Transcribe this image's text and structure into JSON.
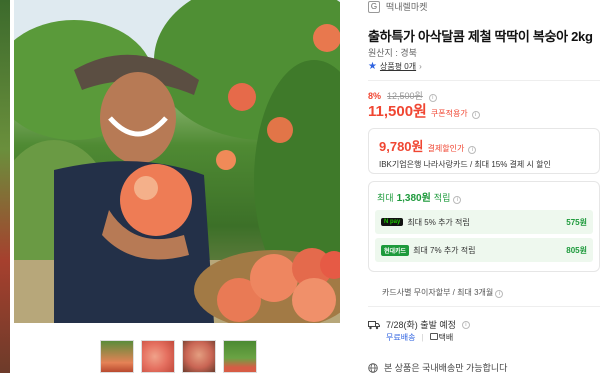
{
  "store": {
    "logo_text": "G",
    "name": "떡내렐마켓"
  },
  "product": {
    "title": "출하특가 아삭달콤 제철 딱딱이 복숭아 2kg",
    "origin": "원산지 : 경북",
    "review_label": "상품평 0개"
  },
  "pricing": {
    "discount_rate": "8%",
    "original_price": "12,500원",
    "price": "11,500원",
    "price_label": "쿠폰적용가"
  },
  "card_offer": {
    "price": "9,780원",
    "label": "결제할인가",
    "description": "IBK기업은행 나라사랑카드 / 최대 15% 결제 시 할인"
  },
  "points": {
    "max_prefix": "최대",
    "max_value": "1,380원",
    "max_suffix": "적립",
    "items": [
      {
        "badge": "N pay",
        "text": "최대 5% 추가 적립",
        "value": "575원"
      },
      {
        "badge": "현대카드",
        "text": "최대 7% 추가 적립",
        "value": "805원"
      }
    ]
  },
  "installment": "카드사별 무이자할부 / 최대 3개월",
  "shipping": {
    "date": "7/28(화) 출발 예정",
    "free": "무료배송",
    "courier": "택배"
  },
  "note": "본 상품은 국내배송만 가능합니다",
  "colors": {
    "accent": "#f04632",
    "points": "#1e9a3c",
    "link": "#2f63e0"
  }
}
